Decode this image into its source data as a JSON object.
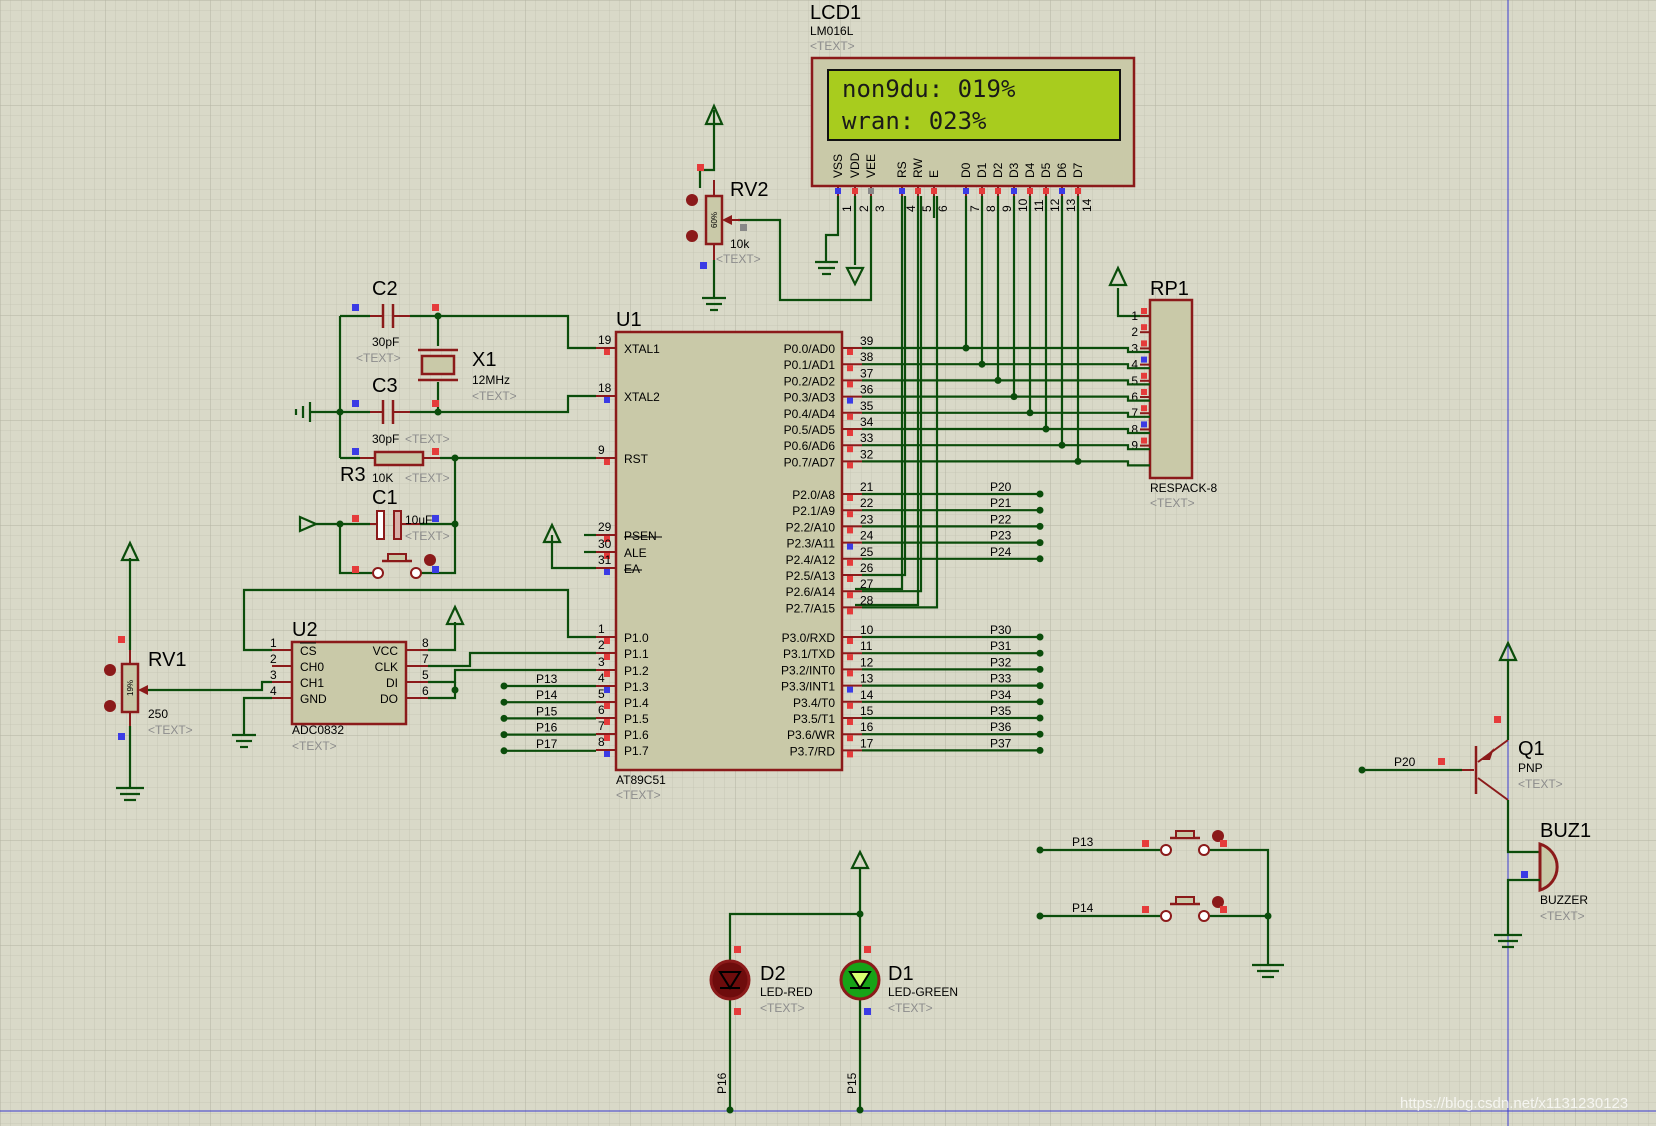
{
  "lcd": {
    "ref": "LCD1",
    "part": "LM016L",
    "text": "<TEXT>",
    "line1": "non9du: 019%",
    "line2": "wran:   023%",
    "pins": [
      "VSS",
      "VDD",
      "VEE",
      "RS",
      "RW",
      "E",
      "D0",
      "D1",
      "D2",
      "D3",
      "D4",
      "D5",
      "D6",
      "D7"
    ],
    "pin_nums": [
      "1",
      "2",
      "3",
      "4",
      "5",
      "6",
      "7",
      "8",
      "9",
      "10",
      "11",
      "12",
      "13",
      "14"
    ]
  },
  "rv2": {
    "ref": "RV2",
    "val": "10k",
    "text": "<TEXT>",
    "pct": "60%"
  },
  "rv1": {
    "ref": "RV1",
    "val": "250",
    "text": "<TEXT>",
    "pct": "19%"
  },
  "rp1": {
    "ref": "RP1",
    "part": "RESPACK-8",
    "text": "<TEXT>",
    "pins": [
      "1",
      "2",
      "3",
      "4",
      "5",
      "6",
      "7",
      "8",
      "9"
    ]
  },
  "c2": {
    "ref": "C2",
    "val": "30pF",
    "text": "<TEXT>"
  },
  "c3": {
    "ref": "C3",
    "val": "30pF",
    "text": "<TEXT>"
  },
  "c1": {
    "ref": "C1",
    "val": "10uF",
    "text": "<TEXT>"
  },
  "x1": {
    "ref": "X1",
    "val": "12MHz",
    "text": "<TEXT>"
  },
  "r3": {
    "ref": "R3",
    "val": "10K",
    "text": "<TEXT>"
  },
  "u1": {
    "ref": "U1",
    "part": "AT89C51",
    "text": "<TEXT>",
    "left": [
      {
        "n": "19",
        "l": "XTAL1"
      },
      {
        "n": "18",
        "l": "XTAL2"
      },
      {
        "n": "9",
        "l": "RST"
      },
      {
        "n": "29",
        "l": "PSEN"
      },
      {
        "n": "30",
        "l": "ALE"
      },
      {
        "n": "31",
        "l": "EA"
      },
      {
        "n": "1",
        "l": "P1.0"
      },
      {
        "n": "2",
        "l": "P1.1"
      },
      {
        "n": "3",
        "l": "P1.2"
      },
      {
        "n": "4",
        "l": "P1.3"
      },
      {
        "n": "5",
        "l": "P1.4"
      },
      {
        "n": "6",
        "l": "P1.5"
      },
      {
        "n": "7",
        "l": "P1.6"
      },
      {
        "n": "8",
        "l": "P1.7"
      }
    ],
    "p0": [
      {
        "n": "39",
        "l": "P0.0/AD0"
      },
      {
        "n": "38",
        "l": "P0.1/AD1"
      },
      {
        "n": "37",
        "l": "P0.2/AD2"
      },
      {
        "n": "36",
        "l": "P0.3/AD3"
      },
      {
        "n": "35",
        "l": "P0.4/AD4"
      },
      {
        "n": "34",
        "l": "P0.5/AD5"
      },
      {
        "n": "33",
        "l": "P0.6/AD6"
      },
      {
        "n": "32",
        "l": "P0.7/AD7"
      }
    ],
    "p2": [
      {
        "n": "21",
        "l": "P2.0/A8"
      },
      {
        "n": "22",
        "l": "P2.1/A9"
      },
      {
        "n": "23",
        "l": "P2.2/A10"
      },
      {
        "n": "24",
        "l": "P2.3/A11"
      },
      {
        "n": "25",
        "l": "P2.4/A12"
      },
      {
        "n": "26",
        "l": "P2.5/A13"
      },
      {
        "n": "27",
        "l": "P2.6/A14"
      },
      {
        "n": "28",
        "l": "P2.7/A15"
      }
    ],
    "p3": [
      {
        "n": "10",
        "l": "P3.0/RXD"
      },
      {
        "n": "11",
        "l": "P3.1/TXD"
      },
      {
        "n": "12",
        "l": "P3.2/INT0"
      },
      {
        "n": "13",
        "l": "P3.3/INT1"
      },
      {
        "n": "14",
        "l": "P3.4/T0"
      },
      {
        "n": "15",
        "l": "P3.5/T1"
      },
      {
        "n": "16",
        "l": "P3.6/WR"
      },
      {
        "n": "17",
        "l": "P3.7/RD"
      }
    ]
  },
  "u2": {
    "ref": "U2",
    "part": "ADC0832",
    "text": "<TEXT>",
    "left": [
      {
        "n": "1",
        "l": "CS"
      },
      {
        "n": "2",
        "l": "CH0"
      },
      {
        "n": "3",
        "l": "CH1"
      },
      {
        "n": "4",
        "l": "GND"
      }
    ],
    "right": [
      {
        "n": "8",
        "l": "VCC"
      },
      {
        "n": "7",
        "l": "CLK"
      },
      {
        "n": "5",
        "l": "DI"
      },
      {
        "n": "6",
        "l": "DO"
      }
    ]
  },
  "nets": {
    "p2": [
      "P20",
      "P21",
      "P22",
      "P23",
      "P24"
    ],
    "p3": [
      "P30",
      "P31",
      "P32",
      "P33",
      "P34",
      "P35",
      "P36",
      "P37"
    ],
    "p1": [
      "P13",
      "P14",
      "P15",
      "P16",
      "P17"
    ]
  },
  "buttons": {
    "b1": "P13",
    "b2": "P14"
  },
  "q1": {
    "ref": "Q1",
    "part": "PNP",
    "text": "<TEXT>",
    "net": "P20"
  },
  "buz1": {
    "ref": "BUZ1",
    "part": "BUZZER",
    "text": "<TEXT>"
  },
  "d2": {
    "ref": "D2",
    "part": "LED-RED",
    "text": "<TEXT>",
    "net": "P16"
  },
  "d1": {
    "ref": "D1",
    "part": "LED-GREEN",
    "text": "<TEXT>",
    "net": "P15"
  },
  "watermark": "https://blog.csdn.net/x1131230123"
}
